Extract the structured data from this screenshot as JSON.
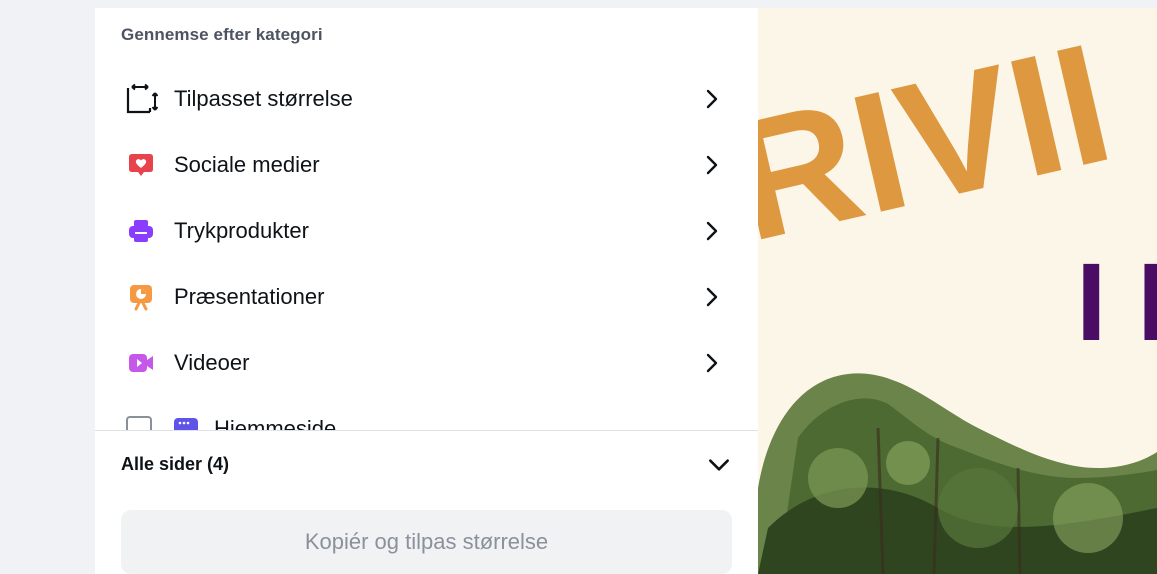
{
  "panel": {
    "section_title": "Gennemse efter kategori",
    "categories": [
      {
        "label": "Tilpasset størrelse",
        "icon": "custom-size-icon",
        "color": "#0e1318"
      },
      {
        "label": "Sociale medier",
        "icon": "heart-chat-icon",
        "color": "#e8424d"
      },
      {
        "label": "Trykprodukter",
        "icon": "printer-icon",
        "color": "#8b3dff"
      },
      {
        "label": "Præsentationer",
        "icon": "presentation-icon",
        "color": "#f59a42"
      },
      {
        "label": "Videoer",
        "icon": "video-camera-icon",
        "color": "#c558e8"
      },
      {
        "label": "Hjemmeside",
        "icon": "website-icon",
        "color": "#6053e8"
      }
    ],
    "pages_selector": {
      "label": "Alle sider (4)",
      "icon": "chevron-down-icon"
    },
    "copy_button": {
      "label": "Kopiér og tilpas størrelse"
    }
  },
  "canvas": {
    "headline": "RIVII",
    "subline": "I I",
    "colors": {
      "background": "#fcf6e8",
      "headline": "#dd9840",
      "subline": "#4a0d63"
    }
  }
}
